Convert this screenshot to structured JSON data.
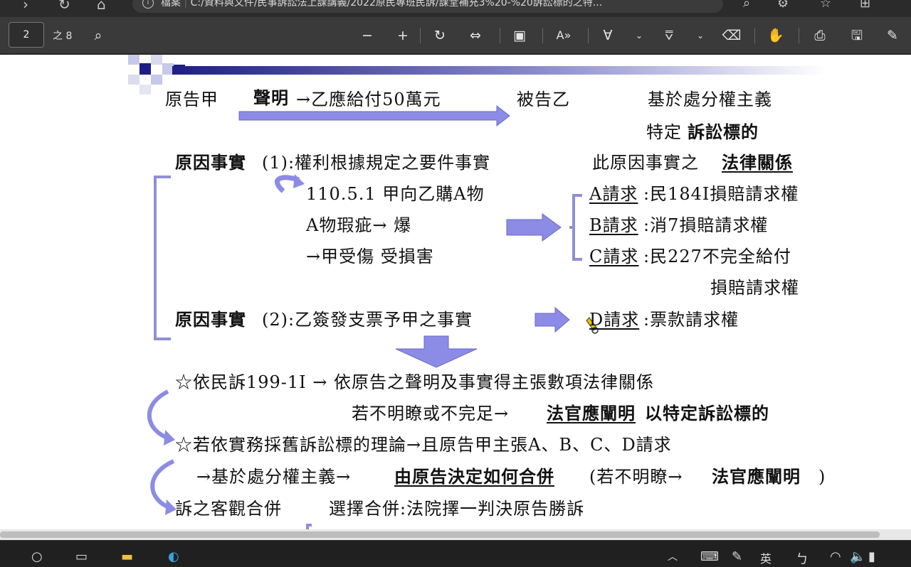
{
  "browser": {
    "tab_label": "檔案",
    "url": "C:/資料與文件/民事訴訟法上課講義/2022原民專班民訴/課堂補充3%20-%20訴訟標的之特..."
  },
  "toolbar": {
    "current_page": "2",
    "total_pages": "之 8"
  },
  "slide": {
    "row1": {
      "plaintiff": "原告甲",
      "claim_bold": "聲明",
      "claim_rest": "→乙應給付50萬元",
      "defendant": "被告乙",
      "principle": "基於處分權主義"
    },
    "row2": {
      "prefix": "特定",
      "bold": "訴訟標的"
    },
    "fact1": {
      "bold": "原因事實",
      "rest": "(1):權利根據規定之要件事實"
    },
    "fact1_right": {
      "prefix": "此原因事實之",
      "bold": "法律關係"
    },
    "detail1": "110.5.1 甲向乙購A物",
    "detail2": "A物瑕疵→ 爆",
    "detail3": "→甲受傷 受損害",
    "claimA": {
      "label": "A請求",
      "rest": ":民184I損賠請求權"
    },
    "claimB": {
      "label": "B請求",
      "rest": ":消7損賠請求權"
    },
    "claimC": {
      "label": "C請求",
      "rest": ":民227不完全給付"
    },
    "claimC2": "損賠請求權",
    "fact2": {
      "bold": "原因事實",
      "rest": "(2):乙簽發支票予甲之事實"
    },
    "claimD": {
      "label": "D請求",
      "rest": ":票款請求權"
    },
    "note1": "☆依民訴199-1I → 依原告之聲明及事實得主張數項法律關係",
    "note1b": {
      "prefix": "若不明瞭或不完足→",
      "bold_u": "法官應闡明",
      "bold": " 以特定訴訟標的"
    },
    "note2": "☆若依實務採舊訴訟標的理論→且原告甲主張A、B、C、D請求",
    "note3": {
      "prefix": "→基於處分權主義→",
      "bold_u": "由原告決定如何合併",
      "mid": "(若不明瞭→",
      "bold": "法官應闡明",
      "end": ")"
    },
    "note4": {
      "left": "訴之客觀合併",
      "right": "選擇合併:法院擇一判決原告勝訴"
    }
  },
  "taskbar": {
    "ime_label": "英"
  },
  "colors": {
    "arrow_fill": "#8c8ce6",
    "bracket": "#8f8fd6",
    "title_bar": "#2a2a8c"
  }
}
